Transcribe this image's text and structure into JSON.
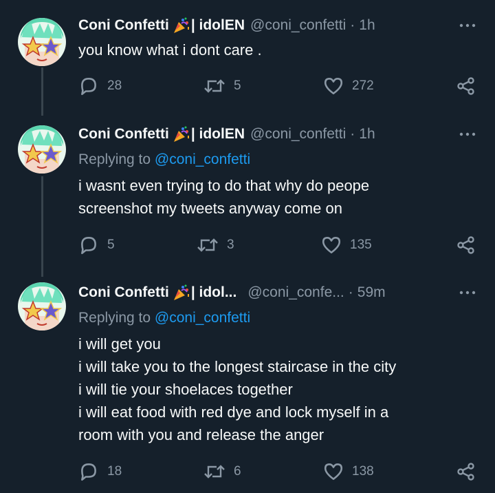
{
  "colors": {
    "background": "#15202b",
    "text": "#f7f9f9",
    "muted": "#8b98a5",
    "link": "#1d9bf0",
    "thread_line": "#38444d"
  },
  "tweets": [
    {
      "name": "Coni Confetti",
      "name_suffix": "| idolEN",
      "handle": "@coni_confetti",
      "time": "1h",
      "replying_prefix": "",
      "replying_to": "",
      "lines": [
        "you know what i dont care ."
      ],
      "replies": "28",
      "retweets": "5",
      "likes": "272"
    },
    {
      "name": "Coni Confetti",
      "name_suffix": "| idolEN",
      "handle": "@coni_confetti",
      "time": "1h",
      "replying_prefix": "Replying to",
      "replying_to": "@coni_confetti",
      "lines": [
        "i wasnt even trying to do that why do peope",
        "screenshot my tweets anyway come on"
      ],
      "replies": "5",
      "retweets": "3",
      "likes": "135"
    },
    {
      "name": "Coni Confetti",
      "name_suffix": "| idol...",
      "handle": "@coni_confe...",
      "time": "59m",
      "replying_prefix": "Replying to",
      "replying_to": "@coni_confetti",
      "lines": [
        "i will get you",
        "i will take you to the longest staircase in the city",
        "i will tie your shoelaces together",
        "i will eat food with red dye and lock myself in a",
        "room with you and release the anger"
      ],
      "replies": "18",
      "retweets": "6",
      "likes": "138"
    }
  ],
  "icons": {
    "reply": "reply-icon",
    "retweet": "retweet-icon",
    "like": "heart-icon",
    "share": "share-icon",
    "more": "more-icon",
    "emoji": "party-popper-icon"
  }
}
